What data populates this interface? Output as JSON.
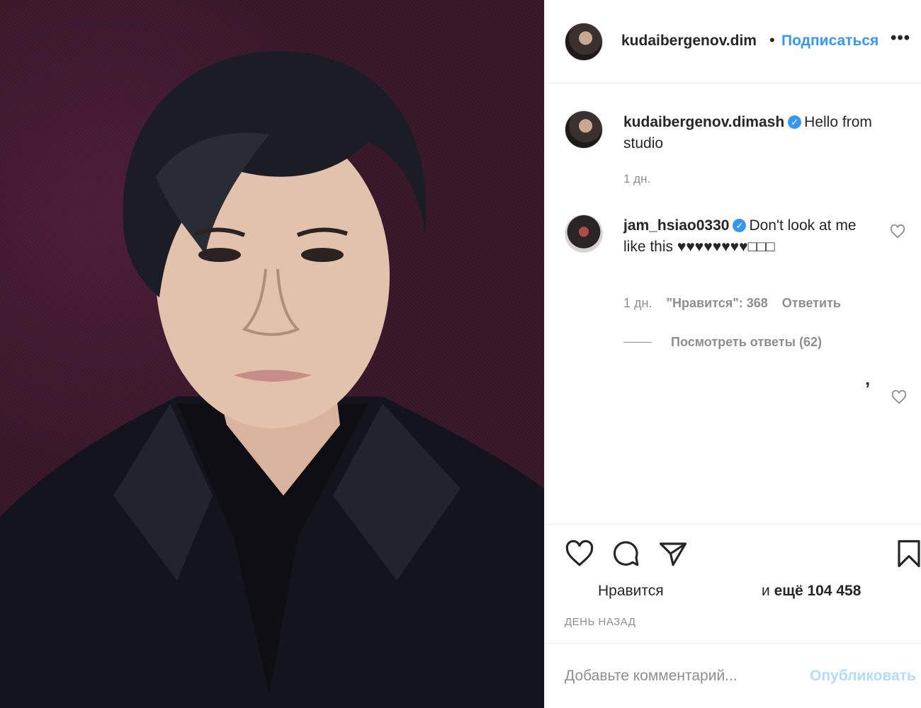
{
  "post": {
    "author": "kudaibergenov.dimash",
    "header_username": "kudaibergenov.dim",
    "follow_label": "Подписаться",
    "more_label": "•••",
    "caption_text": "Hello from studio",
    "caption_time": "1 дн.",
    "verified_icon": "verified-badge-icon"
  },
  "comments": [
    {
      "username": "jam_hsiao0330",
      "text": "Don't look at me like this ♥♥♥♥♥♥♥♥□□□",
      "time": "1 дн.",
      "likes": "\"Нравится\": 368",
      "reply_label": "Ответить",
      "view_replies": "Посмотреть ответы (62)"
    }
  ],
  "actions": {
    "likes_label": "Нравится",
    "likes_more_prefix": "и",
    "likes_more_count": "ещё 104 458",
    "post_time": "ДЕНЬ НАЗАД"
  },
  "comment_box": {
    "placeholder": "Добавьте комментарий...",
    "publish_label": "Опубликовать"
  },
  "colors": {
    "accent": "#3897f0",
    "muted": "#8e8e8e",
    "publish_disabled": "#b3dbff"
  }
}
